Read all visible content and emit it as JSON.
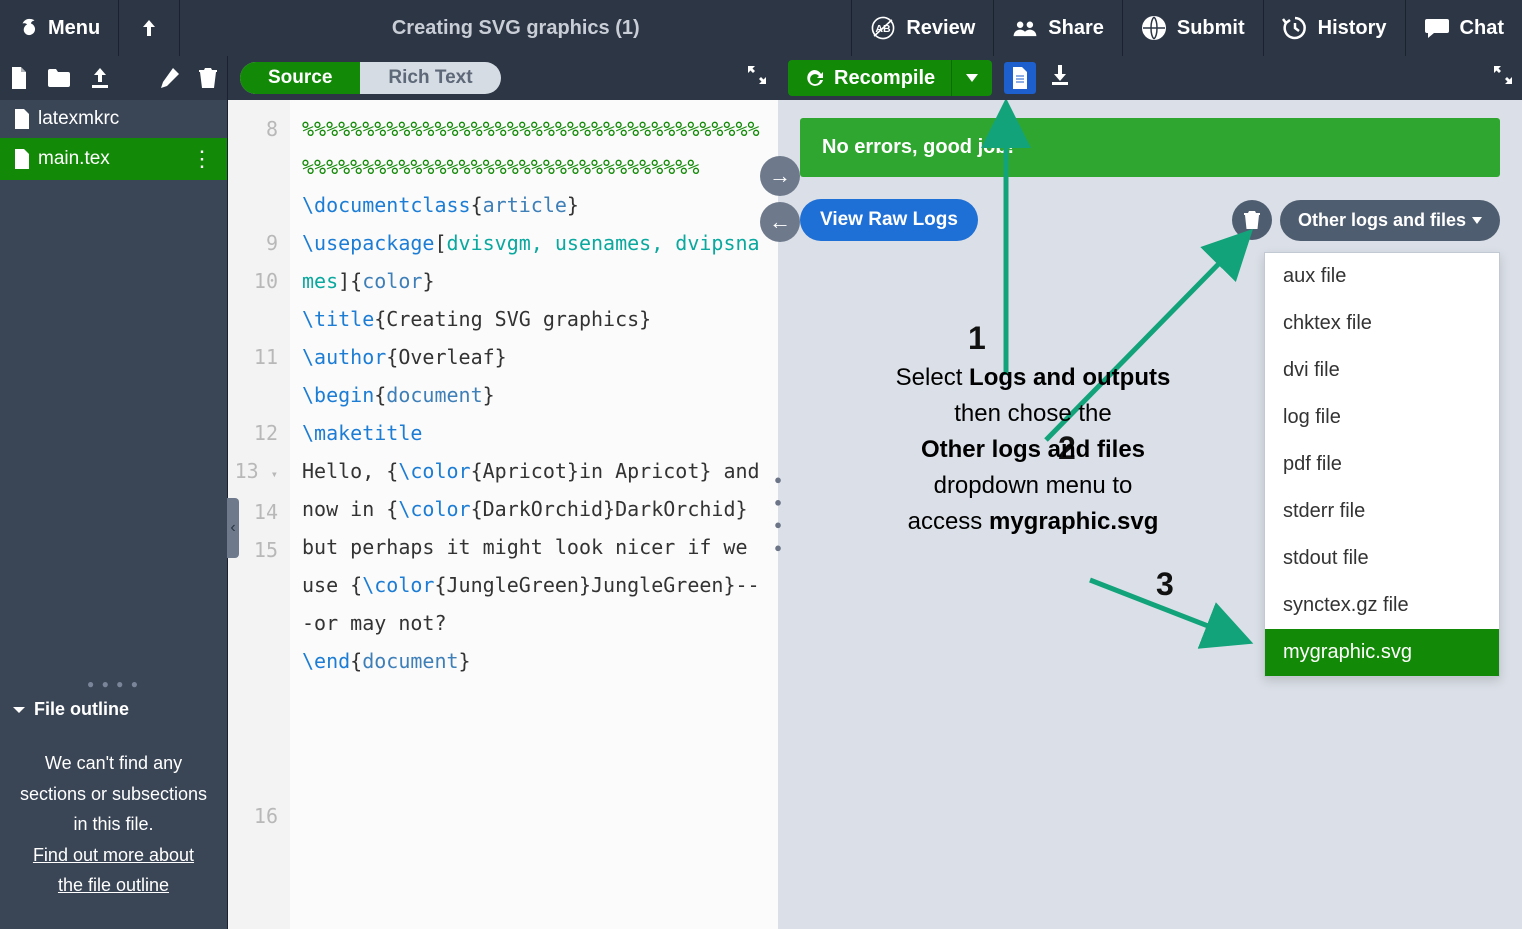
{
  "header": {
    "menu_label": "Menu",
    "project_title": "Creating SVG graphics (1)",
    "review": "Review",
    "share": "Share",
    "submit": "Submit",
    "history": "History",
    "chat": "Chat"
  },
  "editor_tabs": {
    "source": "Source",
    "rich": "Rich Text"
  },
  "recompile_label": "Recompile",
  "files": {
    "items": [
      {
        "name": "latexmkrc"
      },
      {
        "name": "main.tex"
      }
    ]
  },
  "outline": {
    "title": "File outline",
    "body_line1": "We can't find any sections or subsections in this file.",
    "body_link": "Find out more about the file outline"
  },
  "code": {
    "line8": "%%%%%%%%%%%%%%%%%%%%%%%%%%%%%%%%%%%%%%%%%%%%%%%%%%%%%%%%%%%%%%%%%%%%%%%",
    "l9a": "\\documentclass",
    "l9b": "{",
    "l9c": "article",
    "l9d": "}",
    "l10a": "\\usepackage",
    "l10b": "[",
    "l10c": "dvisvgm, usenames, dvipsnames",
    "l10d": "]{",
    "l10e": "color",
    "l10f": "}",
    "l11a": "\\title",
    "l11b": "{Creating SVG graphics}",
    "l12a": "\\author",
    "l12b": "{Overleaf}",
    "l13a": "\\begin",
    "l13b": "{",
    "l13c": "document",
    "l13d": "}",
    "l14a": "\\maketitle",
    "l15_pre": "Hello, {",
    "l15_c1": "\\color",
    "l15_a1": "{Apricot}",
    "l15_t1": "in Apricot} and now in {",
    "l15_c2": "\\color",
    "l15_a2": "{DarkOrchid}",
    "l15_t2": "DarkOrchid} but perhaps it might look nicer if we use {",
    "l15_c3": "\\color",
    "l15_a3": "{JungleGreen}",
    "l15_t3": "JungleGreen}---or may not?",
    "l16a": "\\end",
    "l16b": "{",
    "l16c": "document",
    "l16d": "}"
  },
  "logs": {
    "success": "No errors, good job!",
    "view_raw": "View Raw Logs",
    "other_logs": "Other logs and files",
    "dropdown": [
      "aux file",
      "chktex file",
      "dvi file",
      "log file",
      "pdf file",
      "stderr file",
      "stdout file",
      "synctex.gz file",
      "mygraphic.svg"
    ]
  },
  "annotation": {
    "n1": "1",
    "n2": "2",
    "n3": "3",
    "t1": "Select ",
    "t1b": "Logs and outputs",
    "t2": "then chose the",
    "t3": "Other logs and files",
    "t4": "dropdown menu to",
    "t5": "access ",
    "t5b": "mygraphic.svg"
  }
}
